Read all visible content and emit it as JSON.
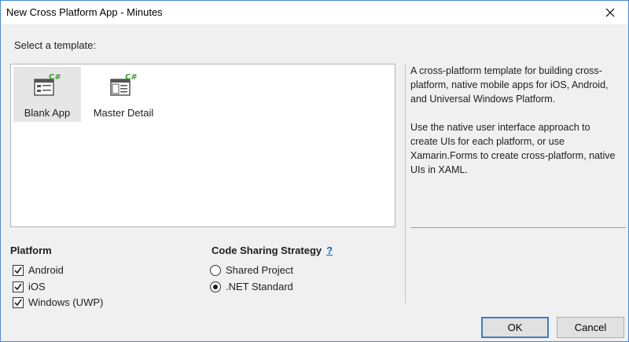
{
  "window": {
    "title": "New Cross Platform App - Minutes",
    "close_icon": "close-icon"
  },
  "templates": {
    "heading": "Select a template:",
    "items": [
      {
        "label": "Blank App",
        "icon": "blank-app-csharp-icon",
        "selected": true
      },
      {
        "label": "Master Detail",
        "icon": "master-detail-csharp-icon",
        "selected": false
      }
    ]
  },
  "description": {
    "paragraph1": "A cross-platform template for building cross-platform, native mobile apps for iOS, Android, and Universal Windows Platform.",
    "paragraph2": "Use the native user interface approach to create UIs for each platform, or use Xamarin.Forms to create cross-platform, native UIs in XAML."
  },
  "platform": {
    "heading": "Platform",
    "options": [
      {
        "label": "Android",
        "checked": true
      },
      {
        "label": "iOS",
        "checked": true
      },
      {
        "label": "Windows (UWP)",
        "checked": true
      }
    ]
  },
  "code_sharing": {
    "heading": "Code Sharing Strategy",
    "help": "?",
    "options": [
      {
        "label": "Shared Project",
        "selected": false
      },
      {
        "label": ".NET Standard",
        "selected": true
      }
    ]
  },
  "buttons": {
    "ok": "OK",
    "cancel": "Cancel"
  },
  "colors": {
    "accent": "#3c7fc6",
    "csharp_badge": "#3d9c2e",
    "link": "#0066cc"
  }
}
